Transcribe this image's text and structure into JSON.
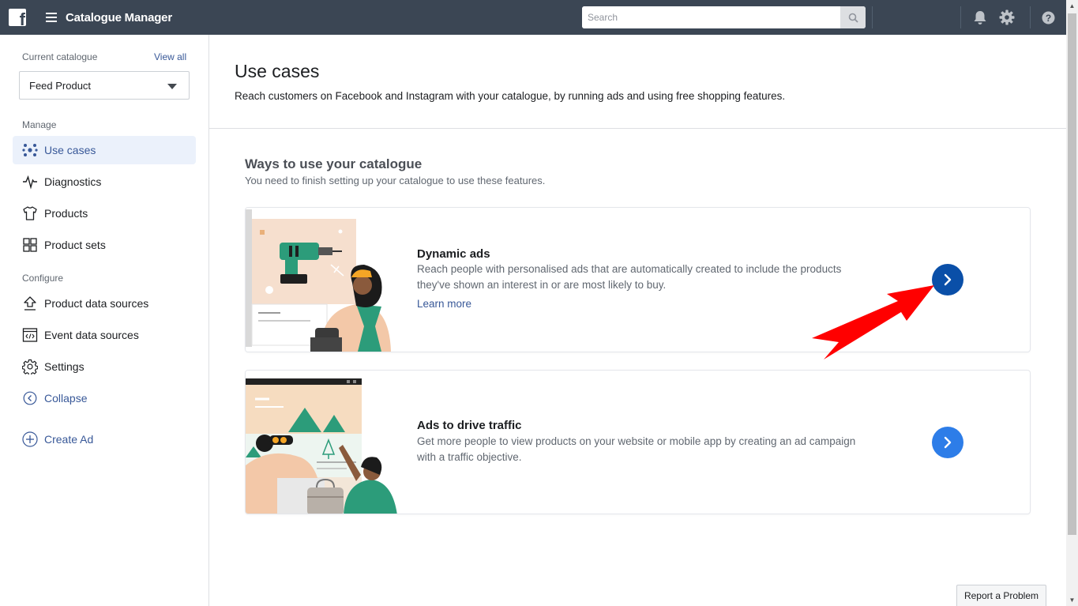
{
  "header": {
    "app_title": "Catalogue Manager",
    "search_placeholder": "Search",
    "icons": [
      "facebook-logo",
      "hamburger-menu-icon",
      "search-icon",
      "bell-icon",
      "gear-icon",
      "help-icon"
    ]
  },
  "sidebar": {
    "current_catalogue_label": "Current catalogue",
    "view_all": "View all",
    "selected_catalogue": "Feed Product",
    "manage_label": "Manage",
    "manage_items": [
      {
        "label": "Use cases",
        "icon": "use-cases-icon",
        "active": true
      },
      {
        "label": "Diagnostics",
        "icon": "pulse-icon"
      },
      {
        "label": "Products",
        "icon": "shirt-icon"
      },
      {
        "label": "Product sets",
        "icon": "grid-icon"
      }
    ],
    "configure_label": "Configure",
    "configure_items": [
      {
        "label": "Product data sources",
        "icon": "upload-icon"
      },
      {
        "label": "Event data sources",
        "icon": "code-window-icon"
      },
      {
        "label": "Settings",
        "icon": "gear-icon"
      }
    ],
    "collapse": "Collapse",
    "create_ad": "Create Ad"
  },
  "main": {
    "title": "Use cases",
    "subtitle": "Reach customers on Facebook and Instagram with your catalogue, by running ads and using free shopping features.",
    "ways_title": "Ways to use your catalogue",
    "ways_subtitle": "You need to finish setting up your catalogue to use these features.",
    "cards": [
      {
        "title": "Dynamic ads",
        "description": "Reach people with personalised ads that are automatically created to include the products they've shown an interest in or are most likely to buy.",
        "link": "Learn more",
        "button_color": "#0a4fa8"
      },
      {
        "title": "Ads to drive traffic",
        "description": "Get more people to view products on your website or mobile app by creating an ad campaign with a traffic objective.",
        "button_color": "#2d7de8"
      }
    ]
  },
  "footer": {
    "report_problem": "Report a Problem"
  },
  "colors": {
    "topbar": "#3b4654",
    "link": "#385898",
    "annotation_arrow": "#ff0000"
  }
}
